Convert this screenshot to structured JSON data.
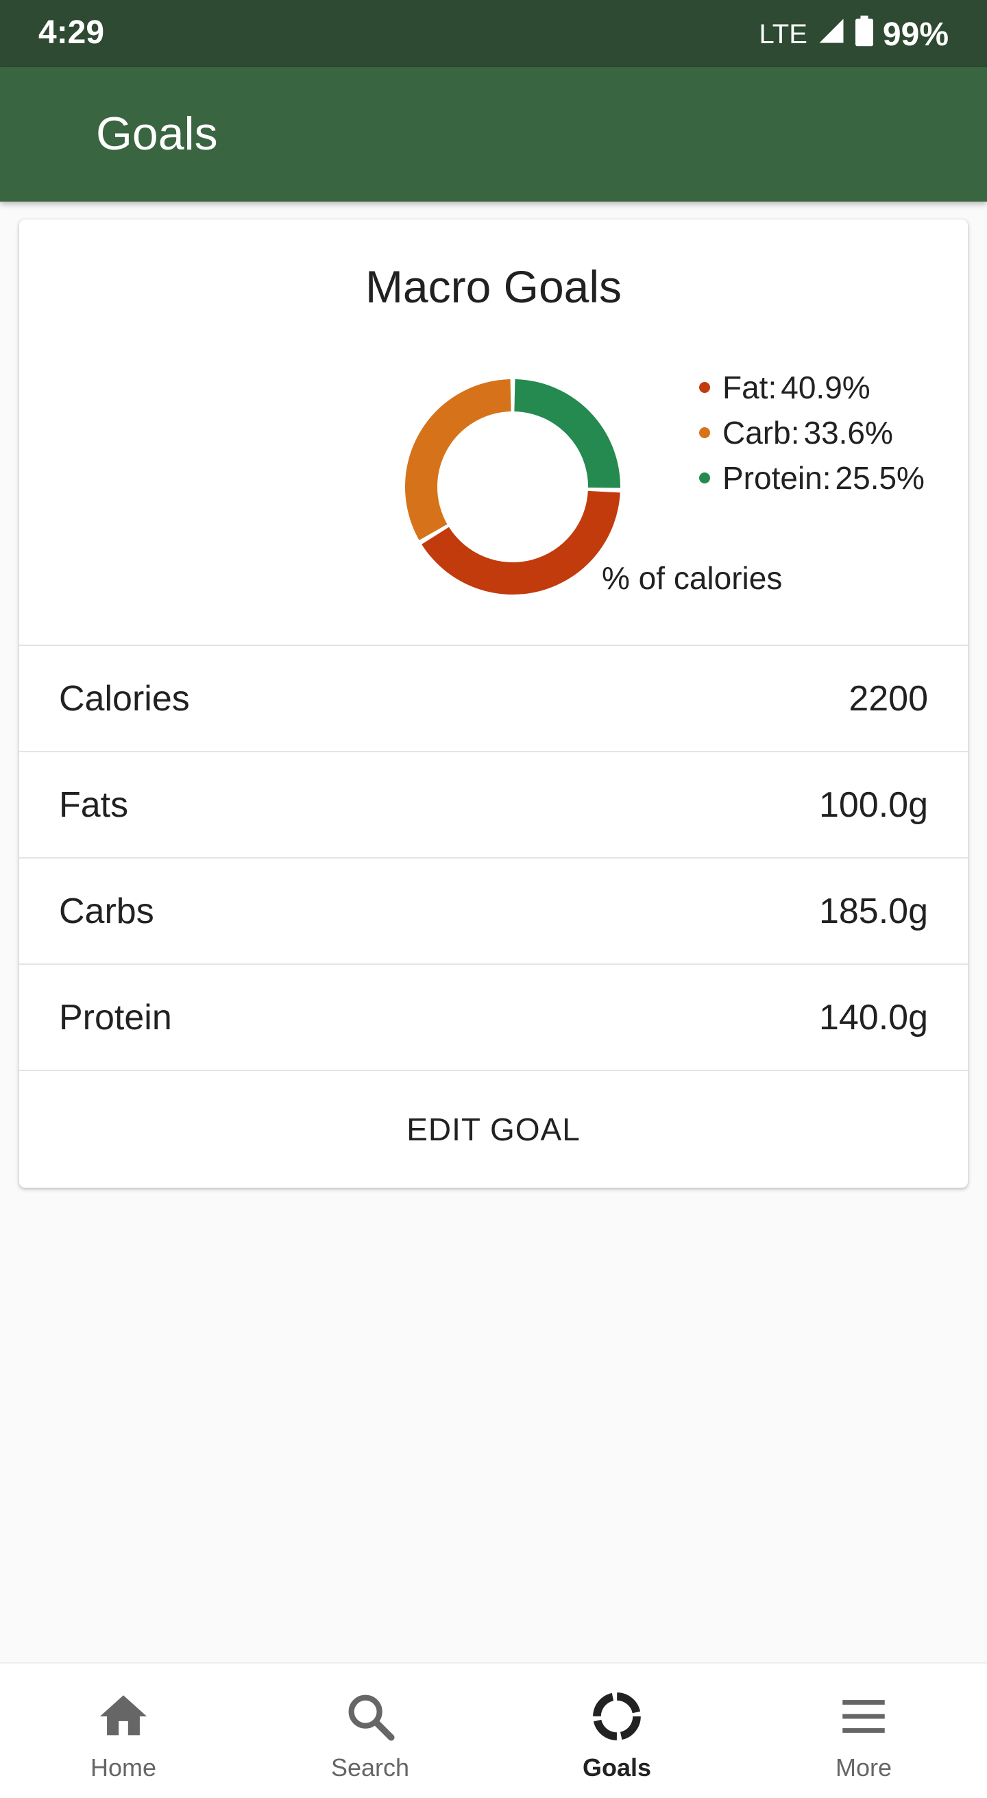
{
  "status_bar": {
    "time": "4:29",
    "network": "LTE",
    "battery": "99%"
  },
  "app_bar": {
    "title": "Goals"
  },
  "card": {
    "title": "Macro Goals",
    "caption": "% of calories",
    "legend": [
      {
        "label": "Fat:",
        "value": "40.9%",
        "color": "#c23b0c"
      },
      {
        "label": "Carb:",
        "value": "33.6%",
        "color": "#d6731a"
      },
      {
        "label": "Protein:",
        "value": "25.5%",
        "color": "#248a50"
      }
    ],
    "rows": [
      {
        "label": "Calories",
        "value": "2200"
      },
      {
        "label": "Fats",
        "value": "100.0g"
      },
      {
        "label": "Carbs",
        "value": "185.0g"
      },
      {
        "label": "Protein",
        "value": "140.0g"
      }
    ],
    "edit_button": "EDIT GOAL"
  },
  "chart_data": {
    "type": "pie",
    "style": "donut",
    "categories": [
      "Fat",
      "Carb",
      "Protein"
    ],
    "values": [
      40.9,
      33.6,
      25.5
    ],
    "colors": [
      "#c23b0c",
      "#d6731a",
      "#248a50"
    ],
    "title": "Macro Goals",
    "legend_position": "right"
  },
  "bottom_nav": {
    "items": [
      {
        "label": "Home",
        "icon": "home-icon",
        "active": false
      },
      {
        "label": "Search",
        "icon": "search-icon",
        "active": false
      },
      {
        "label": "Goals",
        "icon": "donut-icon",
        "active": true
      },
      {
        "label": "More",
        "icon": "menu-icon",
        "active": false
      }
    ]
  }
}
